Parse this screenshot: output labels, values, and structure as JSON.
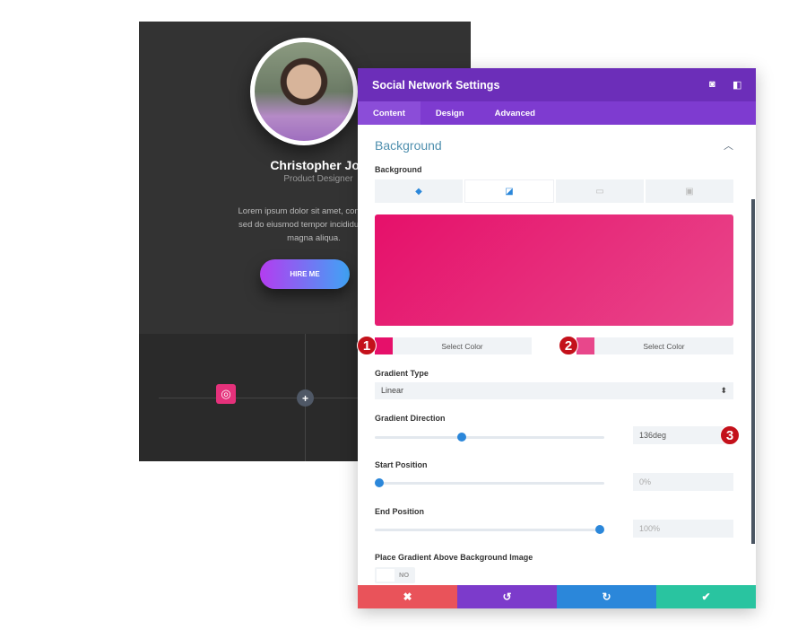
{
  "preview_card": {
    "name": "Christopher Joe",
    "role": "Product Designer",
    "bio_lines": [
      "Lorem ipsum dolor sit amet, consectetur",
      "sed do eiusmod tempor incididunt ut lab",
      "magna aliqua."
    ],
    "button": "HIRE ME",
    "social_icon": "dribbble-icon",
    "add_icon": "plus-icon"
  },
  "panel": {
    "title": "Social Network Settings",
    "header_icons": [
      "focus-icon",
      "sidebar-toggle-icon"
    ],
    "tabs": [
      {
        "label": "Content",
        "active": true
      },
      {
        "label": "Design"
      },
      {
        "label": "Advanced"
      }
    ],
    "section_title": "Background",
    "background_label": "Background",
    "background_types": [
      "color-icon",
      "gradient-icon",
      "image-icon",
      "video-icon"
    ],
    "active_background_type": "gradient",
    "gradient": {
      "start_color": "#e6106a",
      "end_color": "#e8478b"
    },
    "color_pickers": [
      {
        "label": "Select Color",
        "swatch": "#e6106a",
        "badge": "1"
      },
      {
        "label": "Select Color",
        "swatch": "#e8478b",
        "badge": "2"
      }
    ],
    "gradient_type": {
      "label": "Gradient Type",
      "value": "Linear"
    },
    "gradient_direction": {
      "label": "Gradient Direction",
      "value": "136deg",
      "slider": 136,
      "badge": "3"
    },
    "start_position": {
      "label": "Start Position",
      "value": "0%",
      "slider": 0
    },
    "end_position": {
      "label": "End Position",
      "value": "100%",
      "slider": 100
    },
    "place_gradient": {
      "label": "Place Gradient Above Background Image",
      "value": "NO"
    },
    "footer": {
      "cancel": "✖",
      "undo": "↺",
      "redo": "↻",
      "save": "✔"
    },
    "colors": {
      "header": "#6c2eb9",
      "tabs": "#7e3bd0",
      "cancel": "#e9535a",
      "undo": "#7c3bcb",
      "redo": "#2b87da",
      "save": "#29c4a0"
    }
  }
}
